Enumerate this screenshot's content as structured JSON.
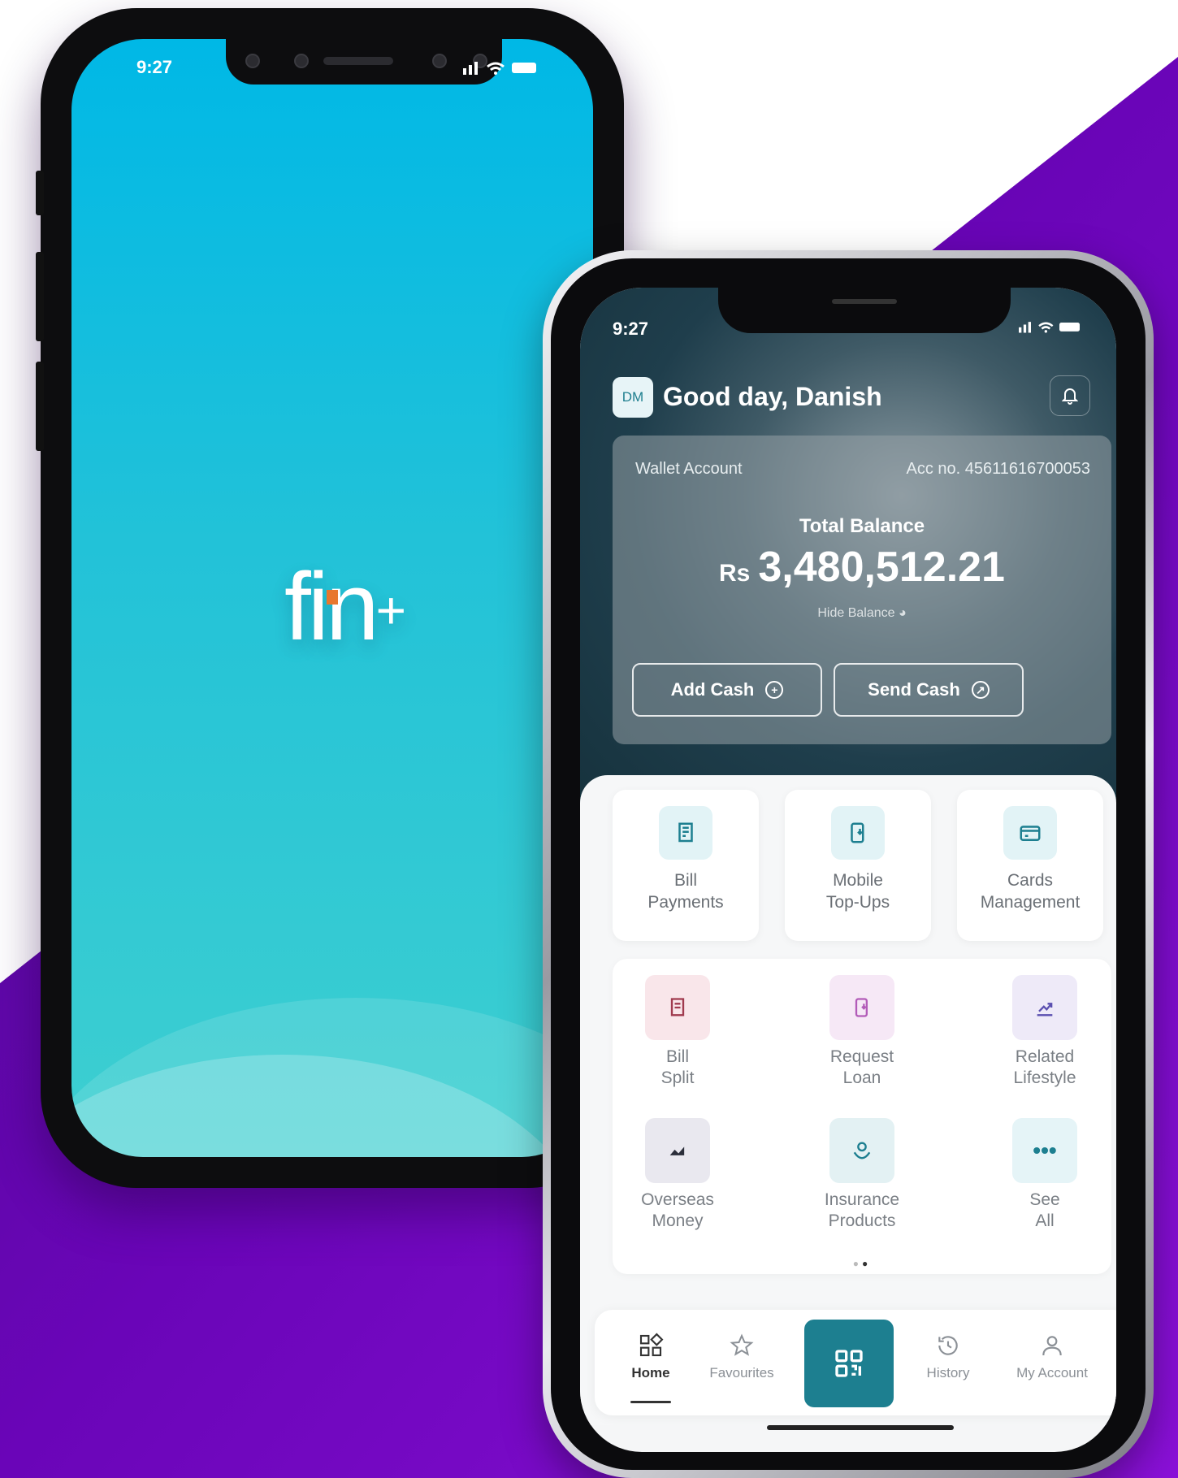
{
  "colors": {
    "purple": "#7a06c9",
    "purple_dark": "#3a0a6e",
    "teal": "#1d7f90",
    "splash": "#00b8e6"
  },
  "splash_phone": {
    "time": "9:27",
    "status_icons": "signal wifi battery",
    "logo_text": "fin",
    "logo_plus": "+"
  },
  "app_phone": {
    "time": "9:27",
    "avatar_initials": "DM",
    "greeting": "Good day, Danish",
    "account": {
      "type": "Wallet Account",
      "number_label": "Acc no. 45611616700053",
      "total_label": "Total Balance",
      "currency": "Rs",
      "balance": "3,480,512.21",
      "hide_label": "Hide Balance"
    },
    "actions": {
      "add_cash": "Add Cash",
      "send_cash": "Send Cash"
    },
    "services": [
      {
        "line1": "Bill",
        "line2": "Payments",
        "icon": "receipt-icon"
      },
      {
        "line1": "Mobile",
        "line2": "Top-Ups",
        "icon": "mobile-download-icon"
      },
      {
        "line1": "Cards",
        "line2": "Management",
        "icon": "card-icon"
      }
    ],
    "tiles": [
      {
        "line1": "Bill",
        "line2": "Split",
        "icon": "split-bill-icon"
      },
      {
        "line1": "Request",
        "line2": "Loan",
        "icon": "loan-icon"
      },
      {
        "line1": "Related",
        "line2": "Lifestyle",
        "icon": "chart-up-icon"
      },
      {
        "line1": "Overseas",
        "line2": "Money",
        "icon": "money-graph-icon"
      },
      {
        "line1": "Insurance",
        "line2": "Products",
        "icon": "insurance-icon"
      },
      {
        "line1": "See",
        "line2": "All",
        "icon": "more-icon"
      }
    ],
    "nav": [
      {
        "label": "Home",
        "icon": "home-icon"
      },
      {
        "label": "Favourites",
        "icon": "star-icon"
      },
      {
        "label": "",
        "icon": "qr-icon"
      },
      {
        "label": "History",
        "icon": "history-icon"
      },
      {
        "label": "My Account",
        "icon": "user-icon"
      }
    ]
  }
}
